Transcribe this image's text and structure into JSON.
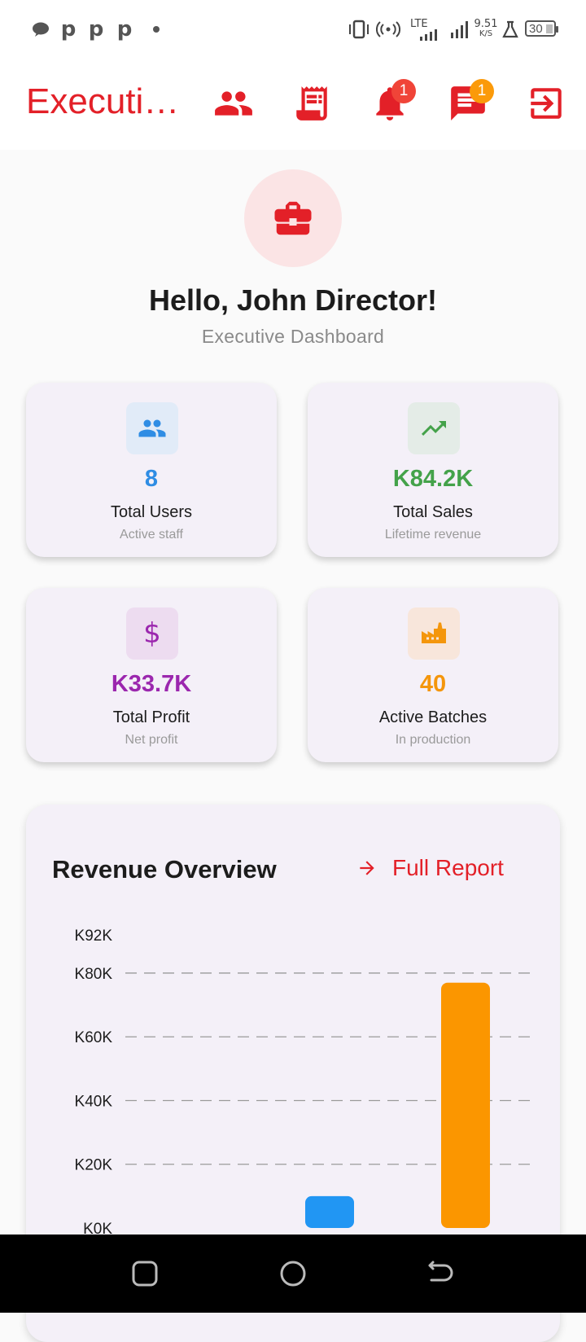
{
  "status_bar": {
    "network": "LTE",
    "speed_value": "9.51",
    "speed_unit": "K/S",
    "battery": "30",
    "notification_icons": [
      "chat-bubble-icon",
      "p-icon",
      "p-icon",
      "p-icon",
      "dot-icon"
    ]
  },
  "app_bar": {
    "title": "Executi…",
    "notifications_badge": "1",
    "messages_badge": "1"
  },
  "hero": {
    "greeting": "Hello, John Director!",
    "subtitle": "Executive Dashboard"
  },
  "stats": [
    {
      "value": "8",
      "label": "Total Users",
      "sub": "Active staff",
      "color": "#2f8de4",
      "bg": "#e1ebf8",
      "icon": "people-icon"
    },
    {
      "value": "K84.2K",
      "label": "Total Sales",
      "sub": "Lifetime revenue",
      "color": "#44a24a",
      "bg": "#e4ece7",
      "icon": "trending-up-icon"
    },
    {
      "value": "K33.7K",
      "label": "Total Profit",
      "sub": "Net profit",
      "color": "#9b27ae",
      "bg": "#eddcf0",
      "icon": "dollar-icon"
    },
    {
      "value": "40",
      "label": "Active Batches",
      "sub": "In production",
      "color": "#f4960c",
      "bg": "#f8e6db",
      "icon": "factory-icon"
    }
  ],
  "revenue": {
    "title": "Revenue Overview",
    "link_label": "Full Report"
  },
  "chart_data": {
    "type": "bar",
    "ytick_labels": [
      "K0K",
      "K20K",
      "K40K",
      "K60K",
      "K80K",
      "K92K"
    ],
    "yticks": [
      0,
      20000,
      40000,
      60000,
      80000,
      92000
    ],
    "ylim": [
      0,
      92000
    ],
    "grid": true,
    "values": [
      10000,
      77000
    ],
    "colors": [
      "#2196f3",
      "#fb9600"
    ]
  },
  "colors": {
    "brand": "#e32028",
    "badge": "#f04438",
    "badge_orange": "#fb9a0a"
  }
}
